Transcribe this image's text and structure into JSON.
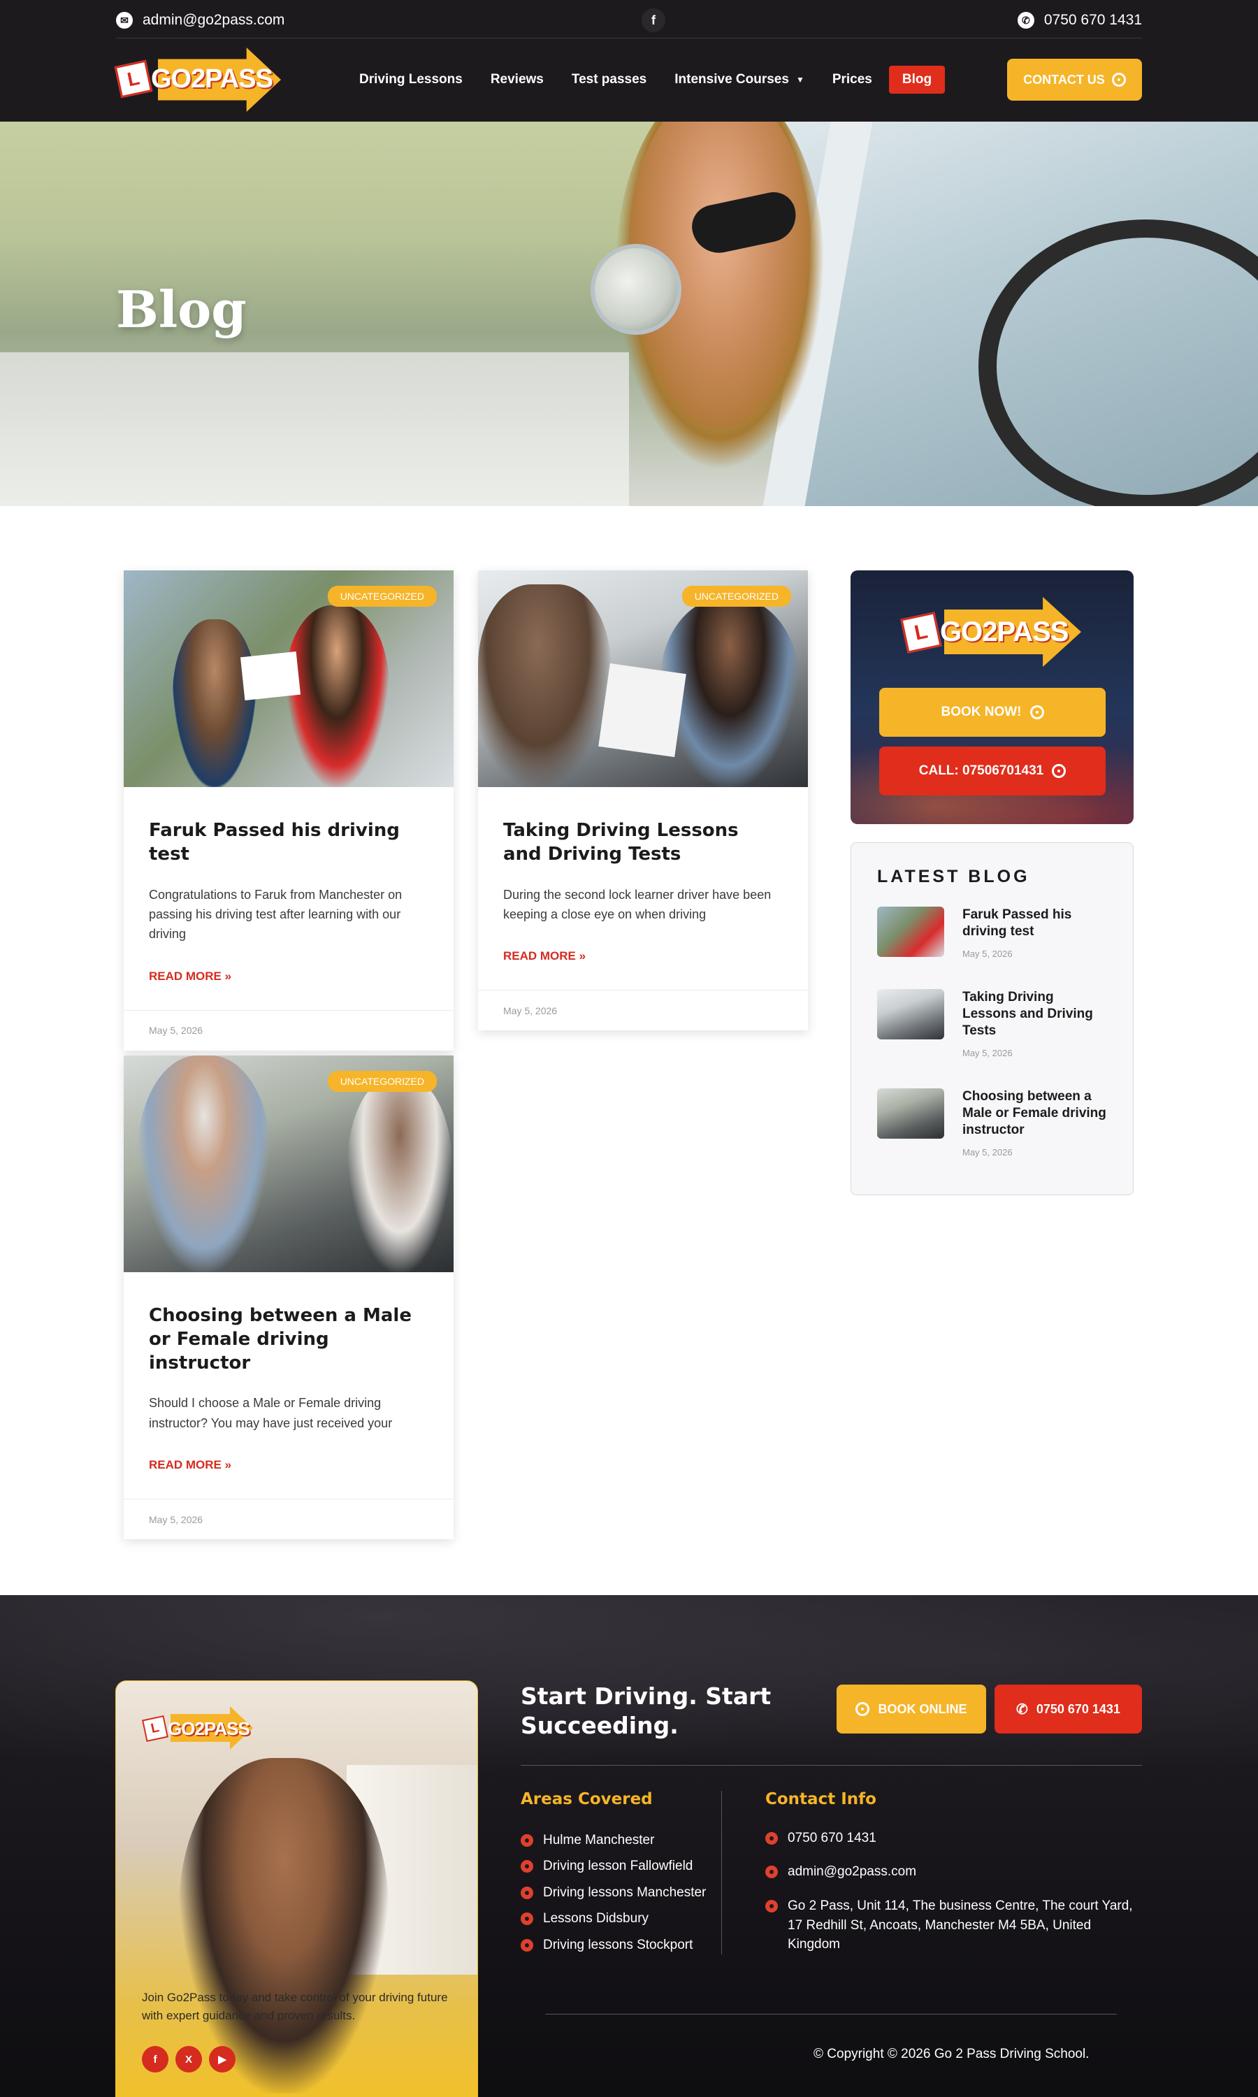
{
  "topbar": {
    "email": "admin@go2pass.com",
    "facebook_icon": "f",
    "phone": "0750 670 1431"
  },
  "logo": {
    "l_plate": "L",
    "text": "GO2PASS"
  },
  "nav": {
    "items": [
      {
        "label": "Driving Lessons"
      },
      {
        "label": "Reviews"
      },
      {
        "label": "Test passes"
      },
      {
        "label": "Intensive Courses"
      },
      {
        "label": "Prices"
      },
      {
        "label": "Blog"
      }
    ],
    "dropdown_icon": "chevron-down-icon",
    "contact_label": "CONTACT US"
  },
  "hero": {
    "title": "Blog"
  },
  "posts": [
    {
      "badge": "UNCATEGORIZED",
      "title": "Faruk Passed his driving test",
      "excerpt": "Congratulations to Faruk from Manchester on passing his driving test after learning with our driving",
      "more": "READ MORE »",
      "date": "May 5, 2026"
    },
    {
      "badge": "UNCATEGORIZED",
      "title": "Taking Driving Lessons and Driving Tests",
      "excerpt": "During the second lock learner driver have been keeping a close eye on when driving",
      "more": "READ MORE »",
      "date": "May 5, 2026"
    },
    {
      "badge": "UNCATEGORIZED",
      "title": "Choosing between a Male or Female driving instructor",
      "excerpt": "Should I choose a Male or Female driving instructor? You may have just received your",
      "more": "READ MORE »",
      "date": "May 5, 2026"
    }
  ],
  "sidebar": {
    "book_label": "BOOK NOW!",
    "call_label": "CALL: 07506701431",
    "latest_title": "LATEST BLOG",
    "latest": [
      {
        "title": "Faruk Passed his driving test",
        "date": "May 5, 2026"
      },
      {
        "title": "Taking Driving Lessons and Driving Tests",
        "date": "May 5, 2026"
      },
      {
        "title": "Choosing between a Male or Female driving instructor",
        "date": "May 5, 2026"
      }
    ]
  },
  "footer": {
    "promo_text": "Join Go2Pass today and take control of your driving future with expert guidance and proven results.",
    "social": [
      "f",
      "X",
      "▶"
    ],
    "headline": "Start Driving. Start Succeeding.",
    "book_online": "BOOK ONLINE",
    "phone_btn": "0750 670 1431",
    "areas_title": "Areas Covered",
    "areas": [
      "Hulme Manchester",
      "Driving lesson Fallowfield",
      "Driving lessons Manchester",
      "Lessons Didsbury",
      "Driving lessons Stockport"
    ],
    "contact_title": "Contact Info",
    "contact_phone": "0750 670 1431",
    "contact_email": "admin@go2pass.com",
    "contact_address": "Go 2 Pass, Unit 114, The business Centre, The court Yard, 17 Redhill St, Ancoats, Manchester M4 5BA, United Kingdom",
    "copyright": "© Copyright © 2026 Go 2 Pass Driving School."
  },
  "colors": {
    "dark": "#1d1a1e",
    "accent_yellow": "#f6b428",
    "accent_red": "#e02d1c"
  }
}
